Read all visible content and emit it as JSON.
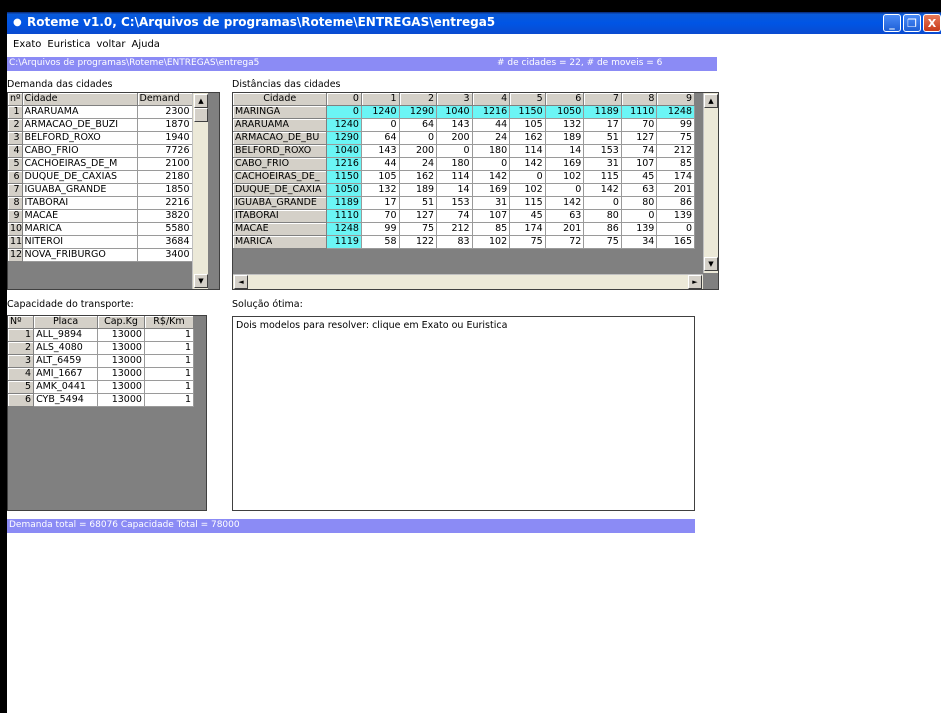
{
  "window": {
    "title": "Roteme v1.0,  C:\\Arquivos de programas\\Roteme\\ENTREGAS\\entrega5",
    "icon": "app-icon",
    "controls": [
      "minimize-icon",
      "restore-icon",
      "close-icon"
    ],
    "minimize_glyph": "_",
    "restore_glyph": "❐",
    "close_glyph": "X"
  },
  "menu": [
    "Exato",
    "Euristica",
    "voltar",
    "Ajuda"
  ],
  "path_bar": {
    "path": "C:\\Arquivos de programas\\Roteme\\ENTREGAS\\entrega5",
    "counts": "# de cidades = 22,  # de moveis = 6"
  },
  "demand": {
    "caption": "Demanda das cidades",
    "headers": [
      "nº",
      "Cidade",
      "Demand"
    ],
    "rows": [
      [
        "1",
        "ARARUAMA",
        "2300"
      ],
      [
        "2",
        "ARMACAO_DE_BUZI",
        "1870"
      ],
      [
        "3",
        "BELFORD_ROXO",
        "1940"
      ],
      [
        "4",
        "CABO_FRIO",
        "7726"
      ],
      [
        "5",
        "CACHOEIRAS_DE_M",
        "2100"
      ],
      [
        "6",
        "DUQUE_DE_CAXIAS",
        "2180"
      ],
      [
        "7",
        "IGUABA_GRANDE",
        "1850"
      ],
      [
        "8",
        "ITABORAI",
        "2216"
      ],
      [
        "9",
        "MACAE",
        "3820"
      ],
      [
        "10",
        "MARICA",
        "5580"
      ],
      [
        "11",
        "NITEROI",
        "3684"
      ],
      [
        "12",
        "NOVA_FRIBURGO",
        "3400"
      ]
    ]
  },
  "distances": {
    "caption": "Distâncias das cidades",
    "headers": [
      "Cidade",
      "0",
      "1",
      "2",
      "3",
      "4",
      "5",
      "6",
      "7",
      "8",
      "9"
    ],
    "rows": [
      [
        "MARINGA",
        "0",
        "1240",
        "1290",
        "1040",
        "1216",
        "1150",
        "1050",
        "1189",
        "1110",
        "1248"
      ],
      [
        "ARARUAMA",
        "1240",
        "0",
        "64",
        "143",
        "44",
        "105",
        "132",
        "17",
        "70",
        "99"
      ],
      [
        "ARMACAO_DE_BU",
        "1290",
        "64",
        "0",
        "200",
        "24",
        "162",
        "189",
        "51",
        "127",
        "75"
      ],
      [
        "BELFORD_ROXO",
        "1040",
        "143",
        "200",
        "0",
        "180",
        "114",
        "14",
        "153",
        "74",
        "212"
      ],
      [
        "CABO_FRIO",
        "1216",
        "44",
        "24",
        "180",
        "0",
        "142",
        "169",
        "31",
        "107",
        "85"
      ],
      [
        "CACHOEIRAS_DE_",
        "1150",
        "105",
        "162",
        "114",
        "142",
        "0",
        "102",
        "115",
        "45",
        "174"
      ],
      [
        "DUQUE_DE_CAXIA",
        "1050",
        "132",
        "189",
        "14",
        "169",
        "102",
        "0",
        "142",
        "63",
        "201"
      ],
      [
        "IGUABA_GRANDE",
        "1189",
        "17",
        "51",
        "153",
        "31",
        "115",
        "142",
        "0",
        "80",
        "86"
      ],
      [
        "ITABORAI",
        "1110",
        "70",
        "127",
        "74",
        "107",
        "45",
        "63",
        "80",
        "0",
        "139"
      ],
      [
        "MACAE",
        "1248",
        "99",
        "75",
        "212",
        "85",
        "174",
        "201",
        "86",
        "139",
        "0"
      ],
      [
        "MARICA",
        "1119",
        "58",
        "122",
        "83",
        "102",
        "75",
        "72",
        "75",
        "34",
        "165"
      ]
    ]
  },
  "transport": {
    "caption": "Capacidade do transporte:",
    "headers": [
      "Nº",
      "Placa",
      "Cap.Kg",
      "R$/Km"
    ],
    "rows": [
      [
        "1",
        "ALL_9894",
        "13000",
        "1"
      ],
      [
        "2",
        "ALS_4080",
        "13000",
        "1"
      ],
      [
        "3",
        "ALT_6459",
        "13000",
        "1"
      ],
      [
        "4",
        "AMI_1667",
        "13000",
        "1"
      ],
      [
        "5",
        "AMK_0441",
        "13000",
        "1"
      ],
      [
        "6",
        "CYB_5494",
        "13000",
        "1"
      ]
    ]
  },
  "solution": {
    "caption": "Solução ótima:",
    "text": "Dois modelos para resolver: clique em Exato ou Euristica"
  },
  "status": "Demanda total = 68076   Capacidade Total = 78000",
  "scroll_glyphs": {
    "up": "▲",
    "down": "▼",
    "left": "◄",
    "right": "►"
  },
  "colors": {
    "titlebar": "#0055e5",
    "infobar": "#8b8bf5",
    "cyan_cells": "#6bf5f5",
    "grid_bg": "#808080"
  }
}
